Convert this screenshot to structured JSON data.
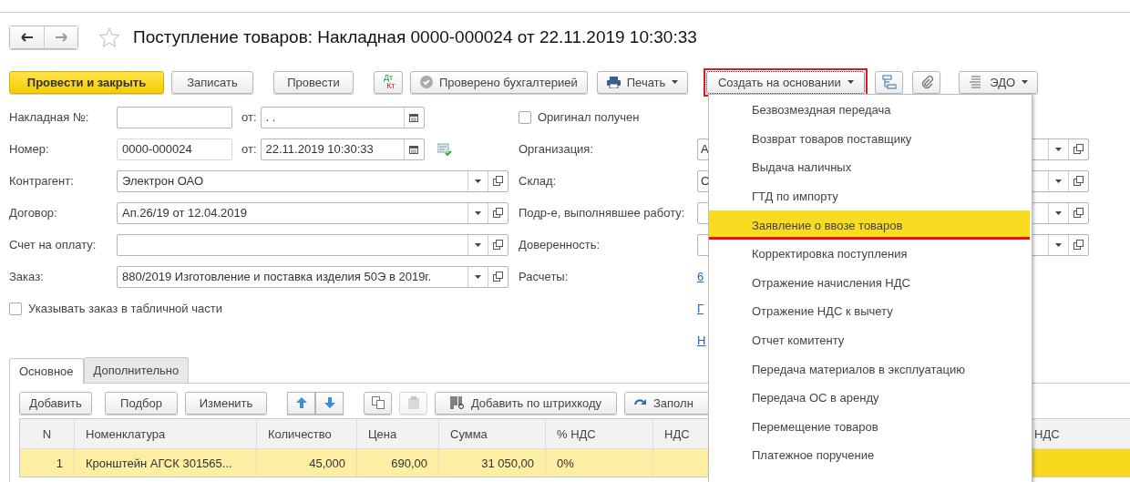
{
  "title": "Поступление товаров: Накладная 0000-000024 от 22.11.2019 10:30:33",
  "toolbar": {
    "post_and_close": "Провести и закрыть",
    "save": "Записать",
    "post": "Провести",
    "dtkt": [
      "Дт",
      "Кт"
    ],
    "checked_by_accounting": "Проверено бухгалтерией",
    "print": "Печать",
    "create_based_on": {
      "label": "Создать на основании",
      "annotated": true
    },
    "edo": "ЭДО"
  },
  "left_fields": [
    {
      "label": "Накладная №:",
      "kind": "number",
      "date_label": "от:",
      "date": ". .",
      "readonly": false
    },
    {
      "label": "Номер:",
      "kind": "number",
      "value": "0000-000024",
      "date_label": "от:",
      "date": "22.11.2019 10:30:33",
      "readonly": true
    },
    {
      "label": "Контрагент:",
      "kind": "select",
      "value": "Электрон ОАО"
    },
    {
      "label": "Договор:",
      "kind": "select",
      "value": "Ап.26/19 от 12.04.2019"
    },
    {
      "label": "Счет на оплату:",
      "kind": "select"
    },
    {
      "label": "Заказ:",
      "kind": "select",
      "value": "880/2019 Изготовление и поставка изделия 50Э в 2019г."
    }
  ],
  "order_in_table": {
    "label": "Указывать заказ в табличной части",
    "checked": false
  },
  "original_received": {
    "label": "Оригинал получен",
    "checked": false
  },
  "right_fields": [
    {
      "label": "Организация:",
      "kind": "select",
      "value": "А"
    },
    {
      "label": "Склад:",
      "kind": "select",
      "value": "С"
    },
    {
      "label": "Подр-е, выполнявшее работу:",
      "kind": "select"
    },
    {
      "label": "Доверенность:",
      "kind": "select"
    },
    {
      "label": "Расчеты:",
      "kind": "link",
      "value": "6"
    }
  ],
  "links": [
    "Г",
    "Н"
  ],
  "tabs": [
    {
      "label": "Основное",
      "selected": true
    },
    {
      "label": "Дополнительно",
      "selected": false
    }
  ],
  "table_toolbar": {
    "add": "Добавить",
    "pick": "Подбор",
    "edit": "Изменить",
    "paste_disabled": true,
    "add_by_barcode": "Добавить по штрихкоду",
    "fill": "Заполн"
  },
  "table": {
    "columns": [
      {
        "label": "N"
      },
      {
        "label": "Номенклатура"
      },
      {
        "label": "Количество"
      },
      {
        "label": "Цена"
      },
      {
        "label": "Сумма"
      },
      {
        "label": "% НДС"
      },
      {
        "label": "НДС"
      },
      {},
      {
        "label": "НДС"
      }
    ],
    "rows": [
      {
        "selected": true,
        "cells": [
          "1",
          "Кронштейн АГСК 301565...",
          "45,000",
          "690,00",
          "31 050,00",
          "0%"
        ]
      }
    ]
  },
  "menu": {
    "items": [
      {
        "label": "Безвозмездная передача",
        "selected": false,
        "annotated": false
      },
      {
        "label": "Возврат товаров поставщику",
        "selected": false,
        "annotated": false
      },
      {
        "label": "Выдача наличных",
        "selected": false,
        "annotated": false
      },
      {
        "label": "ГТД по импорту",
        "selected": false,
        "annotated": false
      },
      {
        "label": "Заявление о ввозе товаров",
        "selected": true,
        "annotated": true
      },
      {
        "label": "Корректировка поступления",
        "selected": false,
        "annotated": false
      },
      {
        "label": "Отражение начисления НДС",
        "selected": false,
        "annotated": false
      },
      {
        "label": "Отражение НДС к вычету",
        "selected": false,
        "annotated": false
      },
      {
        "label": "Отчет комитенту",
        "selected": false,
        "annotated": false
      },
      {
        "label": "Передача материалов в эксплуатацию",
        "selected": false,
        "annotated": false
      },
      {
        "label": "Передача ОС в аренду",
        "selected": false,
        "annotated": false
      },
      {
        "label": "Перемещение товаров",
        "selected": false,
        "annotated": false
      },
      {
        "label": "Платежное поручение",
        "selected": false,
        "annotated": false
      }
    ]
  }
}
